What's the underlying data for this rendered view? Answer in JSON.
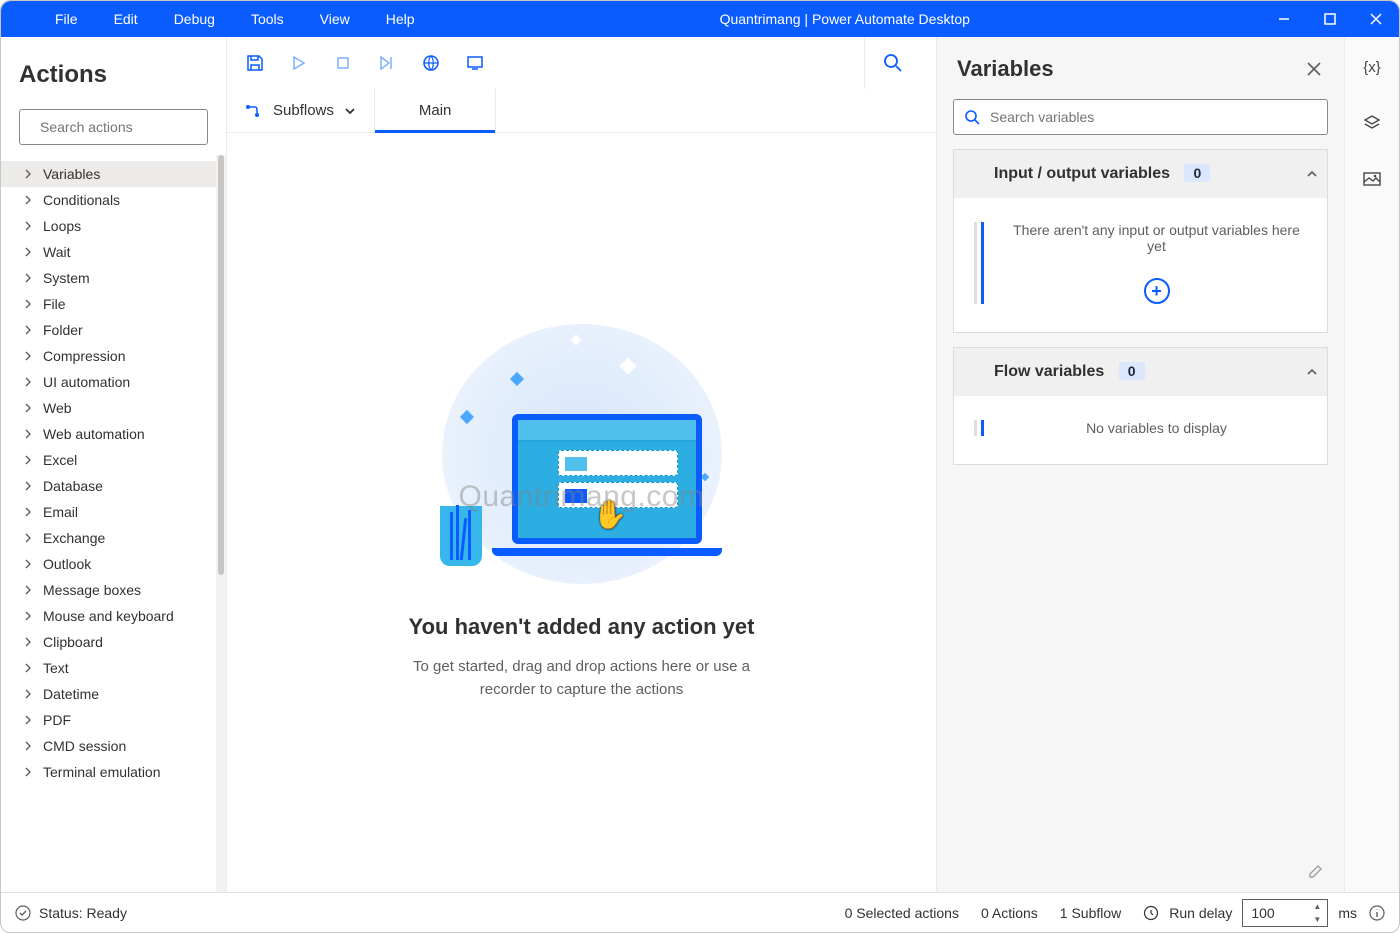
{
  "window": {
    "title": "Quantrimang | Power Automate Desktop",
    "menu": [
      "File",
      "Edit",
      "Debug",
      "Tools",
      "View",
      "Help"
    ]
  },
  "actions_panel": {
    "title": "Actions",
    "search_placeholder": "Search actions",
    "categories": [
      "Variables",
      "Conditionals",
      "Loops",
      "Wait",
      "System",
      "File",
      "Folder",
      "Compression",
      "UI automation",
      "Web",
      "Web automation",
      "Excel",
      "Database",
      "Email",
      "Exchange",
      "Outlook",
      "Message boxes",
      "Mouse and keyboard",
      "Clipboard",
      "Text",
      "Datetime",
      "PDF",
      "CMD session",
      "Terminal emulation"
    ]
  },
  "editor": {
    "subflows_label": "Subflows",
    "active_tab": "Main",
    "empty_title": "You haven't added any action yet",
    "empty_subtitle": "To get started, drag and drop actions here or use a recorder to capture the actions"
  },
  "variables_panel": {
    "title": "Variables",
    "search_placeholder": "Search variables",
    "sections": {
      "io": {
        "title": "Input / output variables",
        "count": "0",
        "empty": "There aren't any input or output variables here yet"
      },
      "flow": {
        "title": "Flow variables",
        "count": "0",
        "empty": "No variables to display"
      }
    }
  },
  "status": {
    "ready_label": "Status: Ready",
    "selected_actions": "0 Selected actions",
    "actions_count": "0 Actions",
    "subflow_count": "1 Subflow",
    "run_delay_label": "Run delay",
    "run_delay_value": "100",
    "ms_label": "ms"
  },
  "watermark": "Quantrimang.com"
}
